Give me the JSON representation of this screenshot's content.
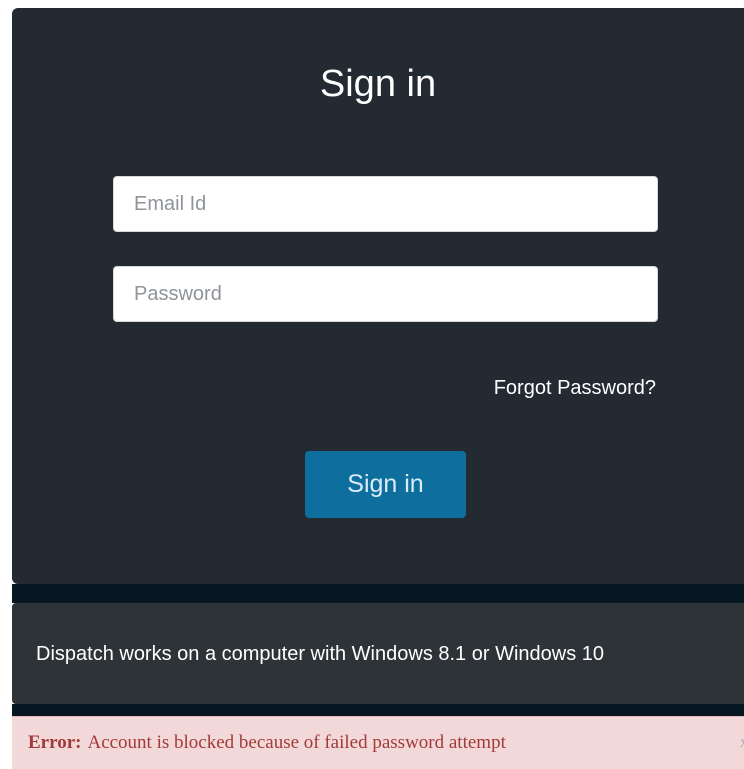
{
  "login_form": {
    "title": "Sign in",
    "email_placeholder": "Email Id",
    "email_value": "",
    "password_placeholder": "Password",
    "password_value": "",
    "forgot_password_label": "Forgot Password?",
    "submit_label": "Sign in"
  },
  "requirements": {
    "message": "Dispatch works on a computer with Windows 8.1 or Windows 10"
  },
  "error_banner": {
    "label": "Error:",
    "message": "Account is blocked because of failed password attempt",
    "close_label": "x"
  },
  "colors": {
    "panel_background": "#232a31",
    "button_background": "#0e6f9f",
    "info_background": "#2e3338",
    "error_background": "#f2d8d8",
    "error_text": "#a33a3a"
  }
}
